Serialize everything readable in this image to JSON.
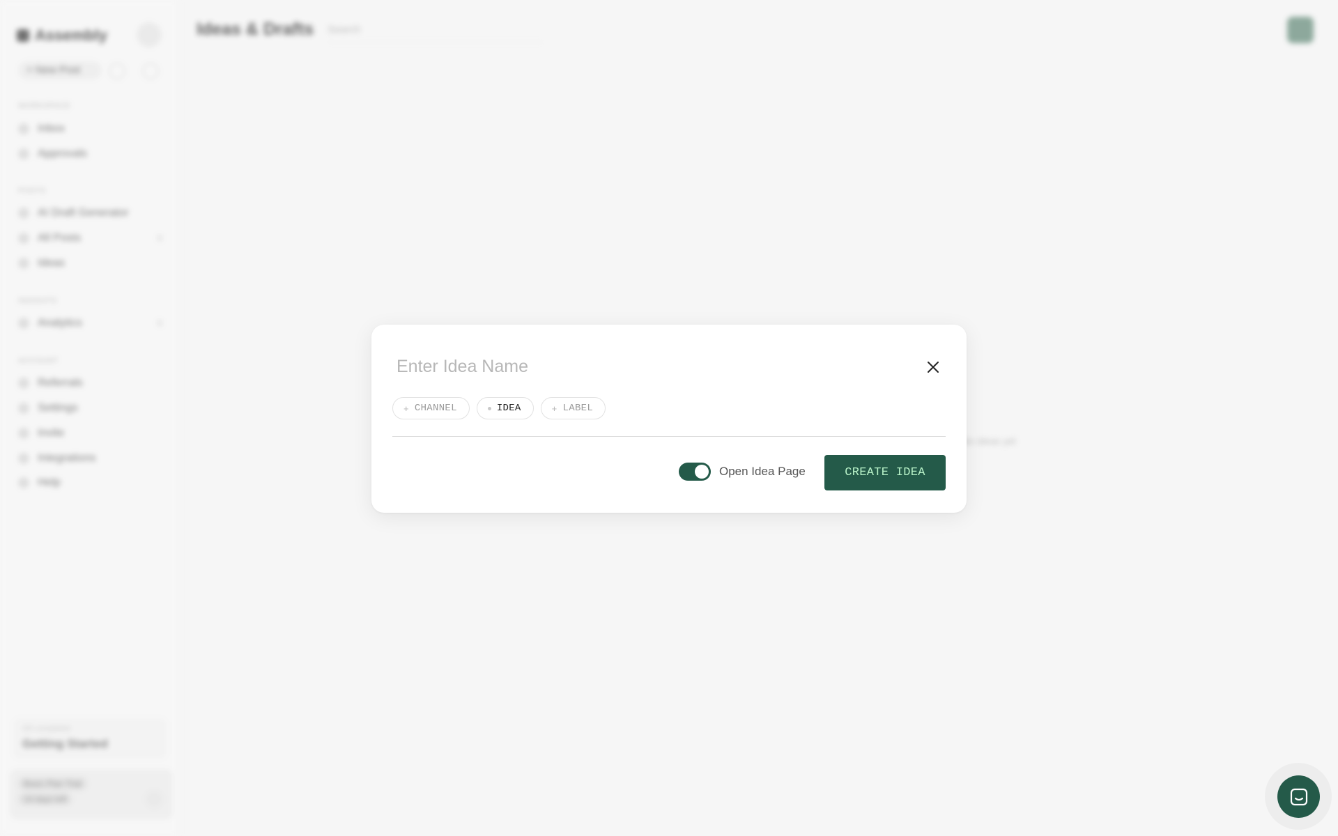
{
  "background": {
    "brand": "Assembly",
    "new_post_label": "+ New Post",
    "sections": [
      {
        "label": "WORKSPACE",
        "items": [
          {
            "label": "Inbox"
          },
          {
            "label": "Approvals"
          }
        ]
      },
      {
        "label": "POSTS",
        "items": [
          {
            "label": "AI Draft Generator"
          },
          {
            "label": "All Posts",
            "count": "0"
          },
          {
            "label": "Ideas"
          }
        ]
      },
      {
        "label": "INSIGHTS",
        "items": [
          {
            "label": "Analytics",
            "count": "0"
          }
        ]
      },
      {
        "label": "ACCOUNT",
        "items": [
          {
            "label": "Referrals"
          },
          {
            "label": "Settings"
          },
          {
            "label": "Invite"
          },
          {
            "label": "Integrations"
          },
          {
            "label": "Help"
          }
        ]
      }
    ],
    "getting_started_small": "0/5 completed",
    "getting_started_title": "Getting Started",
    "trial_line1": "Basic Plan Trial",
    "trial_line2": "14 days left",
    "page_title": "Ideas & Drafts",
    "search_placeholder": "Search",
    "empty_text": "No ideas yet"
  },
  "modal": {
    "name_placeholder": "Enter Idea Name",
    "chips": [
      {
        "label": "CHANNEL",
        "prefix": "+",
        "active": false
      },
      {
        "label": "IDEA",
        "prefix": "dot",
        "active": true
      },
      {
        "label": "LABEL",
        "prefix": "+",
        "active": false
      }
    ],
    "toggle_label": "Open Idea Page",
    "toggle_on": true,
    "create_label": "CREATE IDEA"
  },
  "colors": {
    "accent": "#245a49",
    "accent_text": "#b9f3c9"
  },
  "icons": {
    "close": "close-icon",
    "chat": "chat-bubble-icon"
  }
}
